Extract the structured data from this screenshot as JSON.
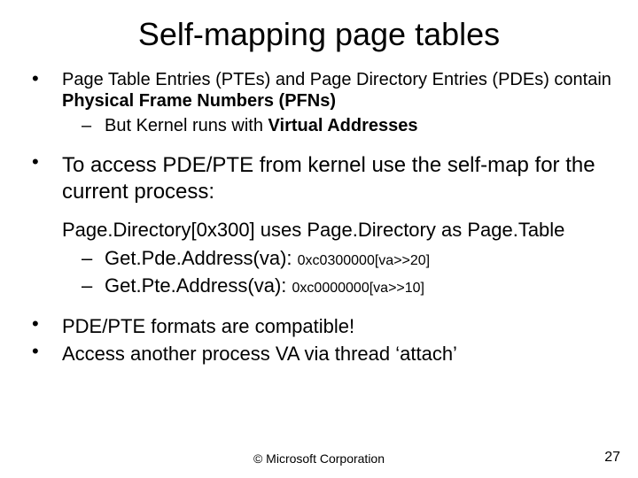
{
  "title": "Self-mapping page tables",
  "bullets": {
    "b1_pre": "Page Table Entries (PTEs) and Page Directory Entries (PDEs) contain ",
    "b1_bold": "Physical Frame Numbers (PFNs)",
    "b1_sub_pre": "But Kernel runs with ",
    "b1_sub_bold": "Virtual Addresses",
    "b2": "To access PDE/PTE from kernel use the self-map for the current process:",
    "b2_hdr": "Page.Directory[0x300] uses Page.Directory as Page.Table",
    "b2_s1_a": "Get.Pde.Address(va): ",
    "b2_s1_b": "0xc0300000[va>>20]",
    "b2_s2_a": "Get.Pte.Address(va):  ",
    "b2_s2_b": "0xc0000000[va>>10]",
    "b3": "PDE/PTE formats are compatible!",
    "b4": "Access another process VA via thread ‘attach’"
  },
  "footer": {
    "copyright": "© Microsoft Corporation",
    "page": "27"
  }
}
